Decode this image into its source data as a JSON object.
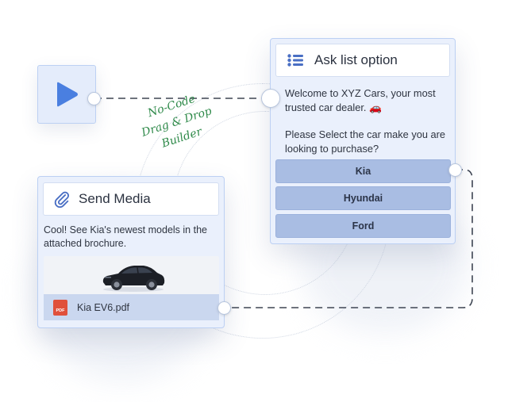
{
  "annotation": {
    "lines": [
      "No-Code",
      "Drag & Drop",
      "Builder"
    ],
    "color": "#2f8a4a"
  },
  "start_node": {
    "icon": "play-icon",
    "color": "#4a7fe0"
  },
  "ask_list": {
    "title": "Ask list option",
    "icon": "list-icon",
    "message_1": "Welcome to XYZ Cars, your most trusted car dealer. 🚗",
    "message_2": "Please Select the car make you are looking to purchase?",
    "options": [
      {
        "label": "Kia"
      },
      {
        "label": "Hyundai"
      },
      {
        "label": "Ford"
      }
    ]
  },
  "send_media": {
    "title": "Send Media",
    "icon": "paperclip-icon",
    "message": "Cool! See Kia's newest models in the attached brochure.",
    "image": "car-image",
    "file_icon": "pdf-icon",
    "file_icon_text": "PDF",
    "file_name": "Kia EV6.pdf"
  },
  "colors": {
    "card_bg": "#eaf0fc",
    "card_border": "#bcd0f3",
    "option_bg": "#a9bde3",
    "connector": "#3e4552"
  }
}
